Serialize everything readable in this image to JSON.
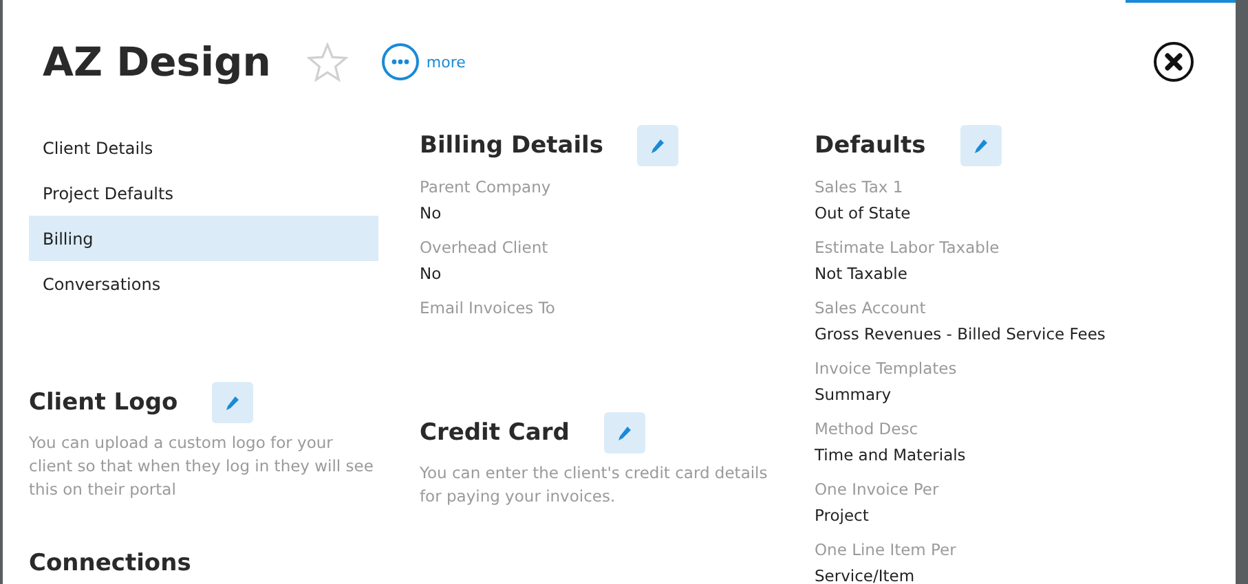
{
  "header": {
    "title": "AZ Design",
    "favorite": false,
    "more_label": "more"
  },
  "sidebar": {
    "items": [
      {
        "label": "Client Details",
        "selected": false
      },
      {
        "label": "Project Defaults",
        "selected": false
      },
      {
        "label": "Billing",
        "selected": true
      },
      {
        "label": "Conversations",
        "selected": false
      }
    ]
  },
  "client_logo": {
    "title": "Client Logo",
    "description": "You can upload a custom logo for your client so that when they log in they will see this on their portal"
  },
  "connections": {
    "title": "Connections"
  },
  "billing_details": {
    "title": "Billing Details",
    "fields": [
      {
        "label": "Parent Company",
        "value": "No"
      },
      {
        "label": "Overhead Client",
        "value": "No"
      },
      {
        "label": "Email Invoices To"
      }
    ]
  },
  "credit_card": {
    "title": "Credit Card",
    "description": "You can enter the client's credit card details for paying your invoices."
  },
  "defaults": {
    "title": "Defaults",
    "fields": [
      {
        "label": "Sales Tax 1",
        "value": "Out of State"
      },
      {
        "label": "Estimate Labor Taxable",
        "value": "Not Taxable"
      },
      {
        "label": "Sales Account",
        "value": "Gross Revenues - Billed Service Fees"
      },
      {
        "label": "Invoice Templates",
        "value": "Summary"
      },
      {
        "label": "Method Desc",
        "value": "Time and Materials"
      },
      {
        "label": "One Invoice Per",
        "value": "Project"
      },
      {
        "label": "One Line Item Per",
        "value": "Service/Item"
      }
    ]
  }
}
